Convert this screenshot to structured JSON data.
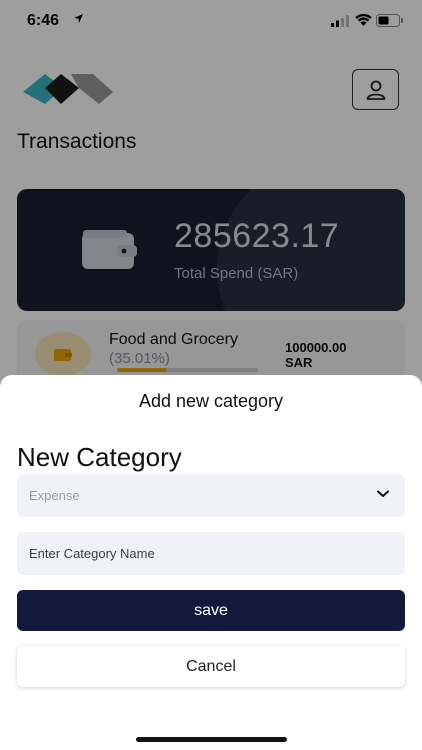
{
  "status_bar": {
    "time": "6:46"
  },
  "header": {
    "title": "Transactions"
  },
  "summary": {
    "amount": "285623.17",
    "label": "Total Spend (SAR)"
  },
  "category": {
    "name": "Food and Grocery",
    "percent": "(35.01%)",
    "progress": 0.3501,
    "amount": "100000.00",
    "currency": "SAR",
    "accent_color": "#e9a60c"
  },
  "sheet": {
    "title": "Add new category",
    "section_title": "New Category",
    "type_select": {
      "value": "Expense"
    },
    "name_input": {
      "placeholder": "Enter Category Name",
      "value": ""
    },
    "save_label": "save",
    "cancel_label": "Cancel"
  },
  "colors": {
    "primary": "#12193a",
    "card_dark": "#1a2030",
    "field_bg": "#f1f1f8"
  }
}
